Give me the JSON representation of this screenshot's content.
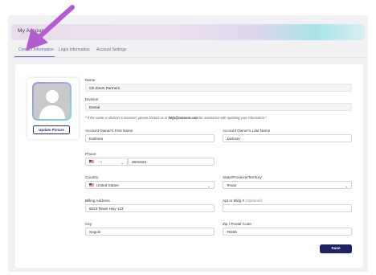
{
  "header": {
    "title": "My Account"
  },
  "tabs": [
    {
      "label": "Contact Information",
      "active": true
    },
    {
      "label": "Login Information",
      "active": false
    },
    {
      "label": "Account Settings",
      "active": false
    }
  ],
  "profile": {
    "update_picture_label": "Update Picture"
  },
  "form": {
    "name": {
      "label": "Name",
      "value": "CE Zoom Partners"
    },
    "division": {
      "label": "Division",
      "value": "Dental"
    },
    "note": {
      "prefix": "* If the name or division is incorrect, please contact us at ",
      "email": "help@cezoom.com",
      "suffix": " for assistance with updating your information.*"
    },
    "owner_first_name": {
      "label": "Account Owner's First Name",
      "value": "Katrinea"
    },
    "owner_last_name": {
      "label": "Account Owner's Last Name",
      "value": "Jackson"
    },
    "phone": {
      "label": "Phone",
      "country_code": "+1",
      "value": "3601623"
    },
    "country": {
      "label": "Country",
      "value": "United States"
    },
    "state": {
      "label": "State/Province/Territory",
      "value": "Texas"
    },
    "billing_address": {
      "label": "Billing Address",
      "value": "6523 Texas Hwy 123"
    },
    "apt": {
      "label": "Apt or Bldg #",
      "optional": "(Optional)",
      "value": ""
    },
    "city": {
      "label": "City",
      "value": "Seguin"
    },
    "zip": {
      "label": "Zip / Postal Code",
      "value": "78155"
    }
  },
  "actions": {
    "save_label": "Save"
  },
  "colors": {
    "accent": "#5a5fb8",
    "primary_button": "#1e2463",
    "arrow": "#b35bd1"
  }
}
